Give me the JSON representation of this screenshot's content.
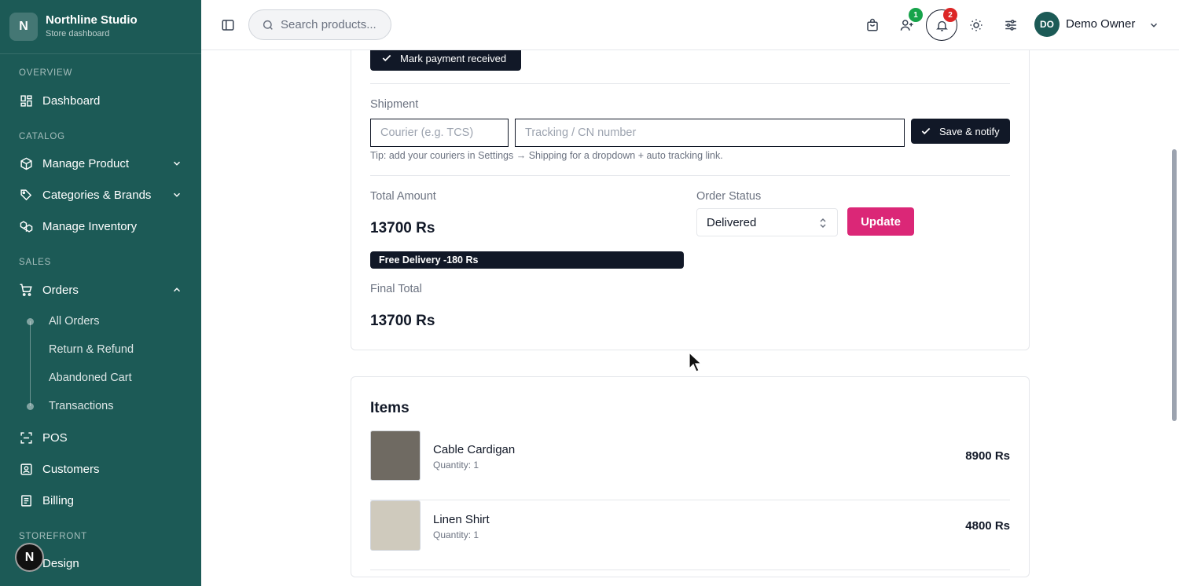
{
  "brand": {
    "logo_letter": "N",
    "name": "Northline Studio",
    "subtitle": "Store dashboard"
  },
  "sidebar": {
    "sections": {
      "overview": "OVERVIEW",
      "catalog": "CATALOG",
      "sales": "SALES",
      "storefront": "STOREFRONT"
    },
    "items": {
      "dashboard": "Dashboard",
      "manage_product": "Manage Product",
      "categories_brands": "Categories & Brands",
      "manage_inventory": "Manage Inventory",
      "orders": "Orders",
      "pos": "POS",
      "customers": "Customers",
      "billing": "Billing",
      "design": "Design"
    },
    "orders_sub": {
      "all_orders": "All Orders",
      "return_refund": "Return & Refund",
      "abandoned_cart": "Abandoned Cart",
      "transactions": "Transactions"
    },
    "floating_button_letter": "N",
    "color": "#1c5a56"
  },
  "header": {
    "search_placeholder": "Search products...",
    "users_badge": "1",
    "notifications_badge": "2",
    "avatar_initials": "DO",
    "user_name": "Demo Owner",
    "icons": [
      "sidebar-toggle-icon",
      "search-icon",
      "shopping-bag-icon",
      "user-plus-icon",
      "bell-icon",
      "sun-icon",
      "sliders-icon",
      "chevron-down-icon"
    ]
  },
  "order": {
    "mark_payment_label": "Mark payment received",
    "shipment_label": "Shipment",
    "courier_placeholder": "Courier (e.g. TCS)",
    "tracking_placeholder": "Tracking / CN number",
    "save_notify_label": "Save & notify",
    "tip": "Tip: add your couriers in Settings → Shipping for a dropdown + auto tracking link.",
    "total_amount_label": "Total Amount",
    "total_amount": "13700 Rs",
    "discount": "Free Delivery -180 Rs",
    "final_total_label": "Final Total",
    "final_total": "13700 Rs",
    "order_status_label": "Order Status",
    "order_status_value": "Delivered",
    "update_label": "Update"
  },
  "items": {
    "title": "Items",
    "list": [
      {
        "name": "Cable Cardigan",
        "quantity": "Quantity: 1",
        "price": "8900 Rs",
        "thumb_color": "#6f6a62"
      },
      {
        "name": "Linen Shirt",
        "quantity": "Quantity: 1",
        "price": "4800 Rs",
        "thumb_color": "#cfcabd"
      }
    ]
  },
  "colors": {
    "accent": "#db2777",
    "dark": "#111827",
    "badge_green": "#16a34a",
    "badge_red": "#dc2626"
  }
}
